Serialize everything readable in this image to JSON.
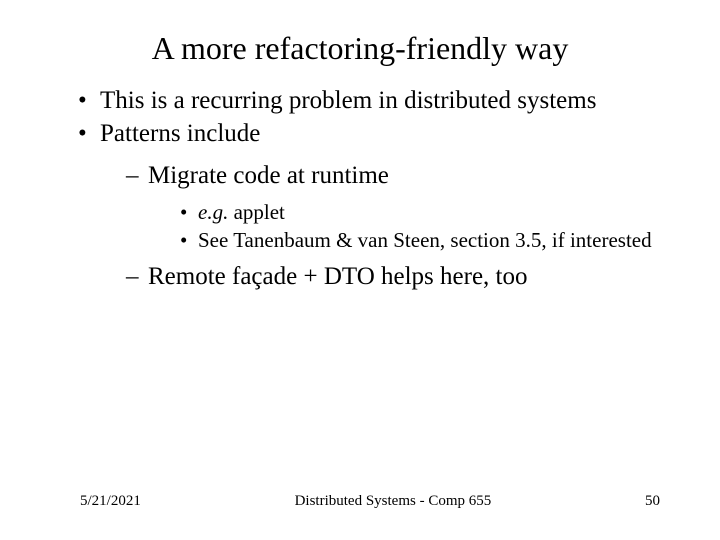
{
  "title": "A more refactoring-friendly way",
  "bullets": {
    "b1": "This is a recurring problem in distributed systems",
    "b2": "Patterns include",
    "b2_1": "Migrate code at runtime",
    "b2_1_1_prefix": "e.g.",
    "b2_1_1_rest": " applet",
    "b2_1_2": "See Tanenbaum & van Steen, section 3.5, if interested",
    "b2_2": "Remote façade + DTO helps here, too"
  },
  "footer": {
    "date": "5/21/2021",
    "course": "Distributed Systems - Comp 655",
    "page": "50"
  }
}
